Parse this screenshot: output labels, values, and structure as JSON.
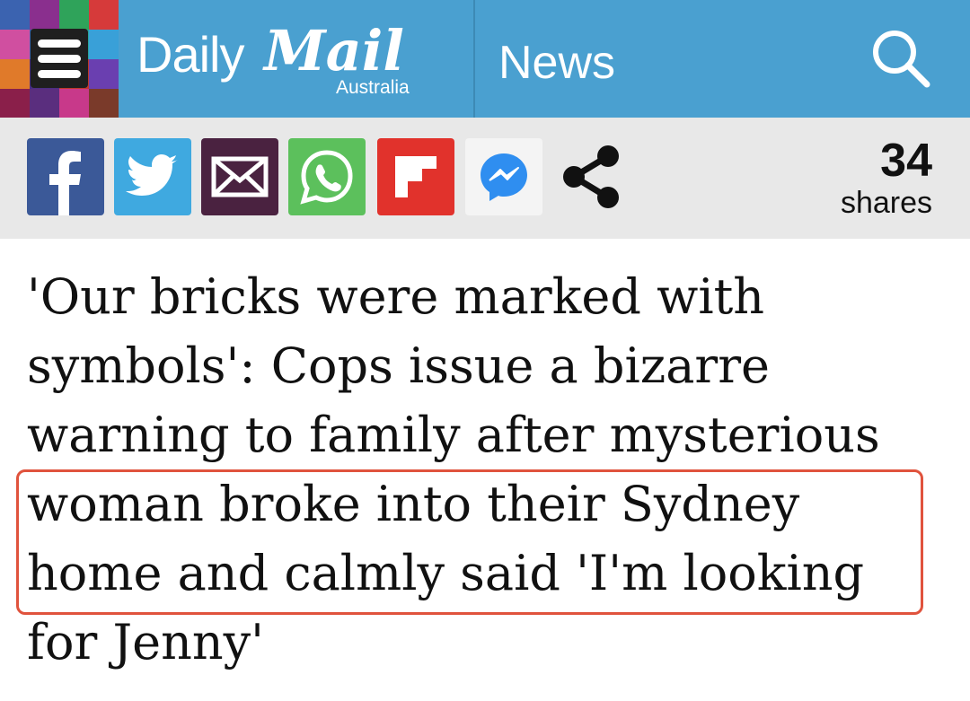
{
  "header": {
    "brand_daily": "Daily",
    "brand_mail": "Mail",
    "brand_region": "Australia",
    "section": "News",
    "colors": {
      "bar": "#4aa0d0",
      "text": "#ffffff"
    },
    "mosaic_colors": [
      "#3b63b0",
      "#8a2f8e",
      "#2fa35a",
      "#d63a3a",
      "#d04fa0",
      "#3b63b0",
      "#2aa7a0",
      "#39a0d8",
      "#e07a2a",
      "#4b2e83",
      "#c0392b",
      "#6a3fb0",
      "#8a1f4a",
      "#5a2e7e",
      "#c8398a",
      "#7a3a2a"
    ]
  },
  "share_bar": {
    "buttons": [
      {
        "name": "facebook",
        "icon": "facebook-icon",
        "color": "#3b5998"
      },
      {
        "name": "twitter",
        "icon": "twitter-icon",
        "color": "#3fa9e0"
      },
      {
        "name": "email",
        "icon": "mail-icon",
        "color": "#4a2240"
      },
      {
        "name": "whatsapp",
        "icon": "whatsapp-icon",
        "color": "#5cc05c"
      },
      {
        "name": "flipboard",
        "icon": "flipboard-icon",
        "color": "#e1322c"
      },
      {
        "name": "messenger",
        "icon": "messenger-icon",
        "color": "#f4f4f4"
      },
      {
        "name": "share",
        "icon": "share-icon",
        "color": "#111111"
      }
    ],
    "count": "34",
    "count_label": "shares"
  },
  "article": {
    "headline_lines": [
      "'Our bricks were marked with",
      "symbols': Cops issue a bizarre",
      "warning to family after mysterious",
      "woman broke into their Sydney",
      "home and calmly said 'I'm looking",
      "for Jenny'"
    ],
    "highlight_color": "#e0533d"
  }
}
